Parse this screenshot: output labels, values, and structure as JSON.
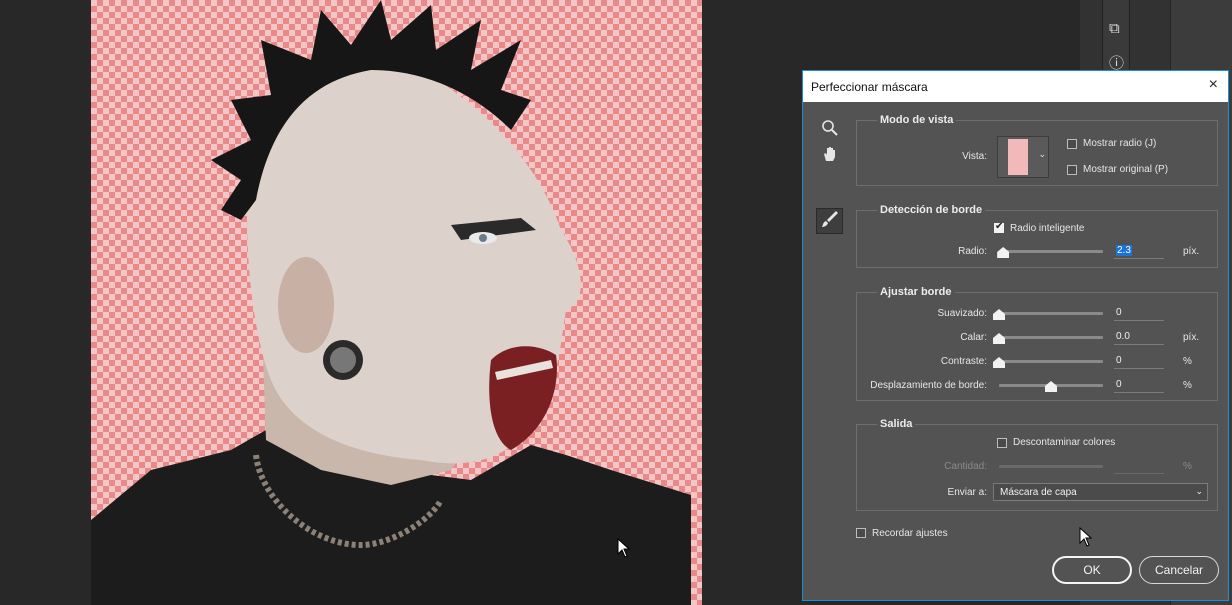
{
  "dialog": {
    "title": "Perfeccionar máscara",
    "close_icon": "×",
    "tools": {
      "zoom_icon": "🔍",
      "hand_icon": "✋",
      "brush_icon": "🖌"
    },
    "view_mode": {
      "legend": "Modo de vista",
      "view_label": "Vista:",
      "show_radius": {
        "label": "Mostrar radio (J)",
        "checked": false
      },
      "show_original": {
        "label": "Mostrar original (P)",
        "checked": false
      }
    },
    "edge_detection": {
      "legend": "Detección de borde",
      "smart_radius": {
        "label": "Radio inteligente",
        "checked": true
      },
      "radius_label": "Radio:",
      "radius_value": "2.3",
      "radius_unit": "píx.",
      "radius_level": 0.04
    },
    "adjust_edge": {
      "legend": "Ajustar borde",
      "rows": [
        {
          "label": "Suavizado:",
          "value": "0",
          "unit": "",
          "level": 0.0
        },
        {
          "label": "Calar:",
          "value": "0.0",
          "unit": "píx.",
          "level": 0.0
        },
        {
          "label": "Contraste:",
          "value": "0",
          "unit": "%",
          "level": 0.0
        },
        {
          "label": "Desplazamiento de borde:",
          "value": "0",
          "unit": "%",
          "level": 0.5
        }
      ]
    },
    "output": {
      "legend": "Salida",
      "decontaminate": {
        "label": "Descontaminar colores",
        "checked": false
      },
      "amount_label": "Cantidad:",
      "amount_unit": "%",
      "send_label": "Enviar a:",
      "send_value": "Máscara de capa"
    },
    "remember": {
      "label": "Recordar ajustes",
      "checked": false
    },
    "ok_label": "OK",
    "cancel_label": "Cancelar"
  },
  "right_panel": {
    "icon_3d": "⧉",
    "info_icon": "ⓘ"
  },
  "colors": {
    "dialog_bg": "#535353",
    "accent": "#1c8fd6",
    "transparency_pink": "#e88a8a"
  }
}
